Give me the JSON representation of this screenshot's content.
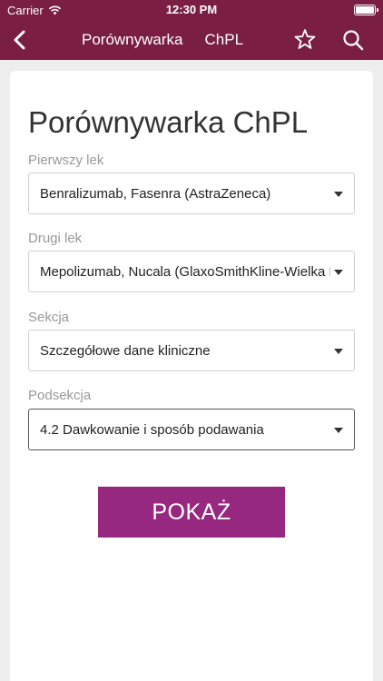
{
  "status_bar": {
    "carrier": "Carrier",
    "time": "12:30 PM"
  },
  "nav": {
    "title_1": "Porównywarka",
    "title_2": "ChPL"
  },
  "form": {
    "title": "Porównywarka ChPL",
    "fields": [
      {
        "label": "Pierwszy lek",
        "value": "Benralizumab, Fasenra (AstraZeneca)"
      },
      {
        "label": "Drugi lek",
        "value": "Mepolizumab, Nucala (GlaxoSmithKline-Wielka Brytania)"
      },
      {
        "label": "Sekcja",
        "value": "Szczegółowe dane kliniczne"
      },
      {
        "label": "Podsekcja",
        "value": "4.2 Dawkowanie i sposób podawania"
      }
    ],
    "show_button": "POKAŻ"
  },
  "colors": {
    "header": "#7a1f43",
    "button": "#962880",
    "background": "#eeeeee"
  }
}
